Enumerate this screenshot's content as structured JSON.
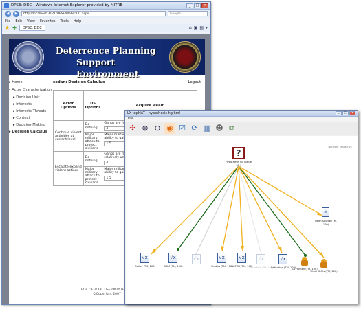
{
  "browser": {
    "title": "DPSE: DDC - Windows Internet Explorer provided by MITRE",
    "url": "http://localhost:3121/DPSE/Web/DDC.aspx",
    "search_placeholder": "Google",
    "menu": [
      "File",
      "Edit",
      "View",
      "Favorites",
      "Tools",
      "Help"
    ],
    "tab_label": "DPSE: DDC"
  },
  "banner": {
    "line1": "Deterrence Planning",
    "line2": "Support Environment"
  },
  "sidebar": {
    "items": [
      {
        "label": "Home",
        "level": 0
      },
      {
        "label": "Actor Characterization",
        "level": 0
      },
      {
        "label": "Decision Unit",
        "level": 1
      },
      {
        "label": "Interests",
        "level": 1
      },
      {
        "label": "Interests Threats",
        "level": 1
      },
      {
        "label": "Context",
        "level": 1
      },
      {
        "label": "Decision-Making",
        "level": 1
      },
      {
        "label": "Decision Calculus",
        "level": 0
      }
    ]
  },
  "main": {
    "user_title": "sodan: Decision Calculus",
    "logout": "Logout",
    "table": {
      "h_actor": "Actor Options",
      "h_us": "US Options",
      "h_acq": "Acquire wealt",
      "rows": [
        {
          "actor": "Continue violent activities at current level",
          "us": "Do nothing",
          "text": "Gangs are free to loot and steal relatively unimpeded",
          "val": "3"
        },
        {
          "actor": "",
          "us": "Major military attack to protect civilians",
          "text": "Major military attack would seriously impede gang ability to gain wealth by looting.",
          "val": "1.5"
        },
        {
          "actor": "Escalate/expand violent actions",
          "us": "Do nothing",
          "text": "Gangs are free to expand scope of loot and steal relatively unimpeded",
          "val": "4"
        },
        {
          "actor": "",
          "us": "Major military attack to protect civilians",
          "text": "Major military attack would seriously impede gang ability to gain wealth by looting.",
          "val": "1.5"
        }
      ],
      "save_label": "Sa"
    },
    "footer1": "FOR OFFICIAL USE ONLY (FOUO)",
    "footer2": "©Copyright 2007"
  },
  "dialog": {
    "title": "LX topHAT - hypothesis hg.hml",
    "menu": "File",
    "legend": "Network Fanatic v1",
    "hypothesis": "Hypothesis hg (value 45 )",
    "nodes": [
      {
        "label": "Collier (TM, 100)",
        "type": "sqrt",
        "faded": false,
        "color": "#f0b020"
      },
      {
        "label": "SSIM (TM, 100)",
        "type": "sqrt",
        "faded": false,
        "color": "#1c6a1c"
      },
      {
        "label": "",
        "type": "sqrt",
        "faded": true,
        "color": "#cfcfcf"
      },
      {
        "label": "Pardiks (TM, 100)",
        "type": "sqrt",
        "faded": false,
        "color": "#f0b020"
      },
      {
        "label": "ROPED (TM, 100)",
        "type": "sqrt",
        "faded": false,
        "color": "#f0b020"
      },
      {
        "label": "Breakfast (TM, 100)",
        "type": "sqrt",
        "faded": true,
        "color": "#e7e7e7"
      },
      {
        "label": "Institution (TM, 100)",
        "type": "sqrt",
        "faded": false,
        "color": "#f0b020"
      },
      {
        "label": "SA Human (TM, 100)",
        "type": "person",
        "faded": false,
        "color": "#1c6a1c"
      },
      {
        "label": "Other SMEs (TM, 100)",
        "type": "person",
        "faded": false,
        "color": "#f0b020"
      },
      {
        "label": "Open Source (TM, 100)",
        "type": "doc",
        "faded": false,
        "color": "#f0b020"
      }
    ]
  }
}
